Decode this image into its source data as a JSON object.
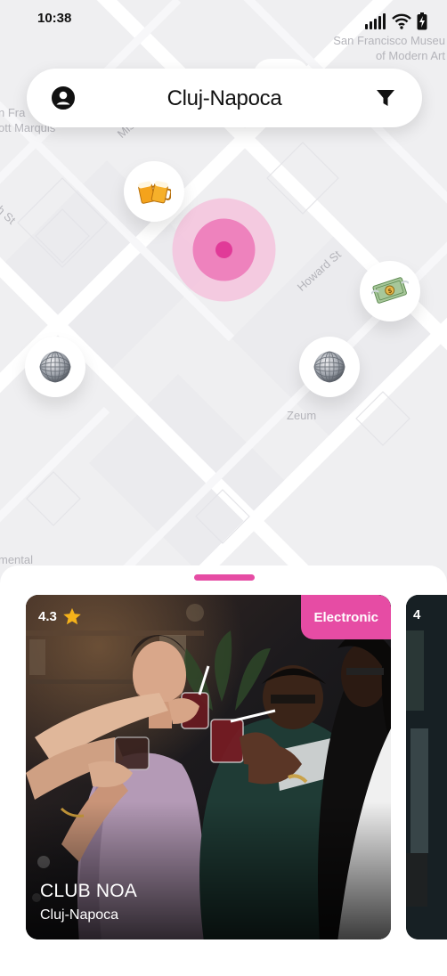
{
  "status_bar": {
    "time": "10:38",
    "icons": [
      "signal-icon",
      "wifi-icon",
      "battery-charging-icon"
    ]
  },
  "search": {
    "city": "Cluj-Napoca",
    "left_icon": "user-circle-icon",
    "right_icon": "filter-icon"
  },
  "map": {
    "labels": {
      "sf_museum_line1": "San Francisco Museu",
      "sf_museum_line2": "of Modern Art",
      "hotel_line1": "n Fra",
      "hotel_line2": "ott Marquis",
      "mission": "Missi",
      "fourth": "4th St",
      "howard": "Howard St",
      "zeum": "Zeum",
      "mental": "mental"
    },
    "markers": [
      {
        "name": "beer",
        "icon": "beer-mugs-icon"
      },
      {
        "name": "money",
        "icon": "money-bill-icon"
      },
      {
        "name": "disco-left",
        "icon": "disco-ball-icon"
      },
      {
        "name": "disco-right",
        "icon": "disco-ball-icon"
      }
    ],
    "colors": {
      "accent": "#e64ca4",
      "map_bg": "#efeff1"
    }
  },
  "venues": [
    {
      "name": "CLUB NOA",
      "city": "Cluj-Napoca",
      "rating": "4.3",
      "genre": "Electronic"
    },
    {
      "rating": "4"
    }
  ]
}
